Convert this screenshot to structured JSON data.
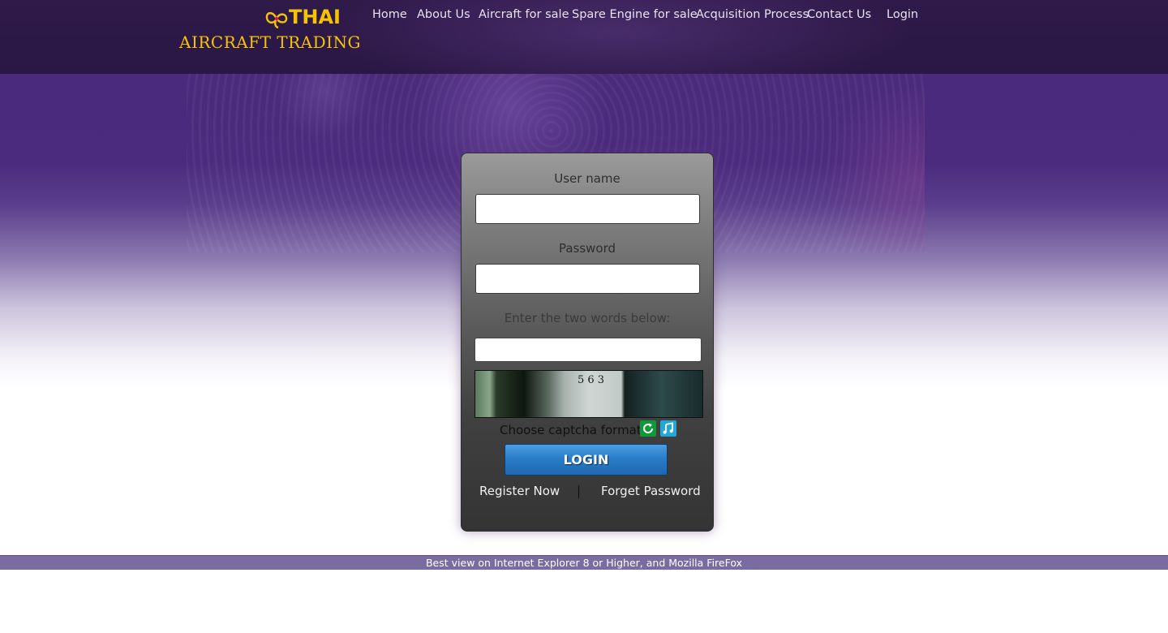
{
  "brand": {
    "name": "THAI",
    "subtitle": "AIRCRAFT TRADING",
    "color": "#f5c400"
  },
  "nav": {
    "items": [
      {
        "label": "Home"
      },
      {
        "label": "About Us"
      },
      {
        "label": "Aircraft for sale"
      },
      {
        "label": "Spare Engine for sale"
      },
      {
        "label": "Acquisition Process"
      },
      {
        "label": "Contact Us"
      },
      {
        "label": "Login"
      }
    ]
  },
  "login": {
    "username_label": "User name",
    "username_value": "",
    "password_label": "Password",
    "password_value": "",
    "captcha_prompt": "Enter the two words below:",
    "captcha_value": "",
    "captcha_digits": "5 6 3",
    "captcha_format_label": "Choose captcha format:",
    "refresh_icon": "refresh-icon",
    "audio_icon": "audio-icon",
    "login_button": "LOGIN",
    "register_link": "Register Now",
    "separator": "|",
    "forgot_link": "Forget Password"
  },
  "footer": {
    "text": "Best view on Internet Explorer 8 or Higher, and Mozilla FireFox"
  },
  "colors": {
    "header_bg": "#2f1a4a",
    "hero_purple": "#4a2a7c",
    "button_blue": "#2a7dc8",
    "footer_bg": "#7a6ca0"
  }
}
